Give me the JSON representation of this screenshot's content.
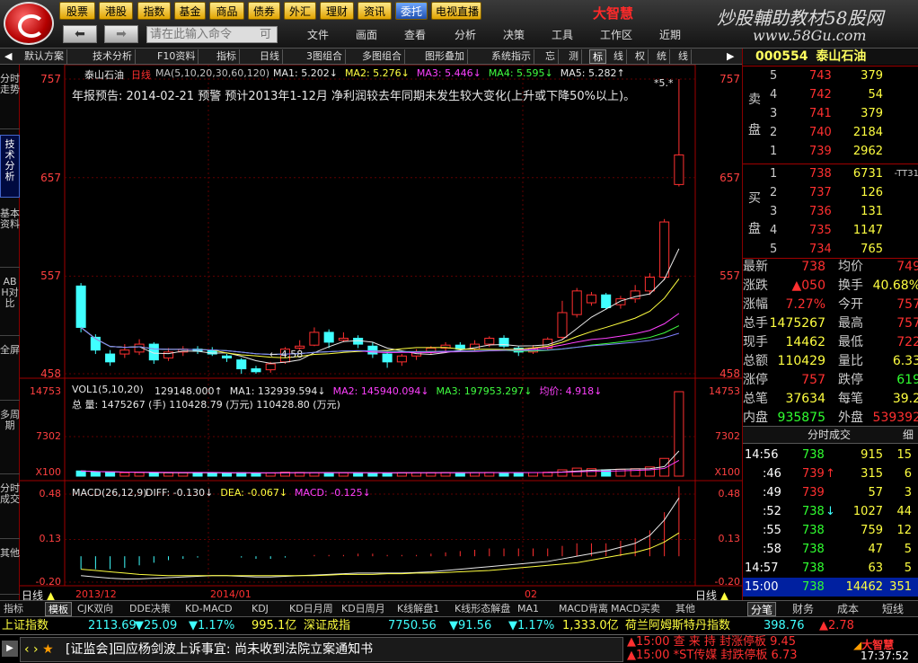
{
  "menu": {
    "top_buttons": [
      "股票",
      "港股",
      "指数",
      "基金",
      "商品",
      "债券",
      "外汇",
      "理财",
      "资讯",
      "委托",
      "电视直播"
    ],
    "active_button": "委托",
    "brand": "大智慧",
    "site_title": "炒股輔助教材58股网",
    "site_url": "www.58Gu.com",
    "cmd_placeholder": "请在此输入命令",
    "cmd_hint": "可",
    "menu_items": [
      "文件",
      "画面",
      "查看",
      "分析",
      "决策",
      "工具",
      "工作区",
      "近期"
    ]
  },
  "toolbar2": [
    "默认方案",
    "技术分析",
    "F10资料",
    "指标",
    "日线",
    "3图组合",
    "多图组合",
    "图形叠加",
    "系统指示",
    "忘",
    "测",
    "标",
    "线",
    "权",
    "统",
    "线"
  ],
  "lefttabs": [
    "分时走势",
    "技术分析",
    "基本资料",
    "ABH对比",
    "全屏",
    "多周期",
    "分时成交",
    "其他"
  ],
  "chart": {
    "stock_name": "泰山石油",
    "period": "日线",
    "ma_params": "MA(5,10,20,30,60,120)",
    "ma_values": [
      {
        "label": "MA1:",
        "value": "5.202",
        "dir": "↓",
        "color": "#e8e8e8"
      },
      {
        "label": "MA2:",
        "value": "5.276",
        "dir": "↓",
        "color": "#ffff40"
      },
      {
        "label": "MA3:",
        "value": "5.446",
        "dir": "↓",
        "color": "#ff40ff"
      },
      {
        "label": "MA4:",
        "value": "5.595",
        "dir": "↓",
        "color": "#40ff40"
      },
      {
        "label": "MA5:",
        "value": "5.282",
        "dir": "↑",
        "color": "#e8e8e8"
      }
    ],
    "announcement": "年报预告: 2014-02-21    预警    预计2013年1-12月   净利润较去年同期未发生较大变化(上升或下降50%以上)。",
    "price_axis": [
      "757",
      "657",
      "557",
      "458"
    ],
    "low_marker": "4.58",
    "high_marker": "*5.*",
    "volume_title": "VOL1(5,10,20)",
    "volume_line": [
      {
        "label": "",
        "value": "129148.000",
        "dir": "↑",
        "color": "#e8e8e8"
      },
      {
        "label": "MA1:",
        "value": "132939.594",
        "dir": "↓",
        "color": "#e8e8e8"
      },
      {
        "label": "MA2:",
        "value": "145940.094",
        "dir": "↓",
        "color": "#ff40ff"
      },
      {
        "label": "MA3:",
        "value": "197953.297",
        "dir": "↓",
        "color": "#40ff40"
      },
      {
        "label": "均价:",
        "value": "4.918",
        "dir": "↓",
        "color": "#ff40ff"
      }
    ],
    "total_line": "总 量: 1475267 (手)  110428.79 (万元)  110428.80 (万元)",
    "vol_axis": [
      "14753",
      "7302",
      "X100"
    ],
    "macd_title": "MACD(26,12,9)",
    "macd_line": [
      {
        "label": "DIFF:",
        "value": "-0.130",
        "dir": "↓",
        "color": "#e8e8e8"
      },
      {
        "label": "DEA:",
        "value": "-0.067",
        "dir": "↓",
        "color": "#ffff40"
      },
      {
        "label": "MACD:",
        "value": "-0.125",
        "dir": "↓",
        "color": "#ff40ff"
      }
    ],
    "macd_axis": [
      "0.48",
      "0.13",
      "-0.20"
    ],
    "date_labels": [
      "2013/12",
      "2014/01",
      "02"
    ],
    "period_label": "日线"
  },
  "chart_data": {
    "type": "candlestick",
    "stock": "泰山石油",
    "ylim": [
      458,
      757
    ],
    "candles": [
      {
        "o": 547,
        "c": 505,
        "h": 550,
        "l": 500
      },
      {
        "o": 495,
        "c": 482,
        "h": 498,
        "l": 478
      },
      {
        "o": 478,
        "c": 470,
        "h": 482,
        "l": 466
      },
      {
        "o": 478,
        "c": 482,
        "h": 488,
        "l": 474
      },
      {
        "o": 480,
        "c": 488,
        "h": 493,
        "l": 477
      },
      {
        "o": 488,
        "c": 472,
        "h": 490,
        "l": 468
      },
      {
        "o": 474,
        "c": 480,
        "h": 484,
        "l": 471
      },
      {
        "o": 480,
        "c": 483,
        "h": 486,
        "l": 476
      },
      {
        "o": 483,
        "c": 481,
        "h": 486,
        "l": 478
      },
      {
        "o": 482,
        "c": 478,
        "h": 485,
        "l": 476
      },
      {
        "o": 476,
        "c": 474,
        "h": 478,
        "l": 470
      },
      {
        "o": 472,
        "c": 463,
        "h": 474,
        "l": 458
      },
      {
        "o": 463,
        "c": 460,
        "h": 466,
        "l": 458
      },
      {
        "o": 462,
        "c": 468,
        "h": 470,
        "l": 459
      },
      {
        "o": 470,
        "c": 483,
        "h": 485,
        "l": 468
      },
      {
        "o": 484,
        "c": 486,
        "h": 492,
        "l": 482
      },
      {
        "o": 487,
        "c": 500,
        "h": 505,
        "l": 486
      },
      {
        "o": 500,
        "c": 490,
        "h": 503,
        "l": 484
      },
      {
        "o": 492,
        "c": 494,
        "h": 500,
        "l": 490
      },
      {
        "o": 494,
        "c": 488,
        "h": 497,
        "l": 484
      },
      {
        "o": 486,
        "c": 478,
        "h": 490,
        "l": 474
      },
      {
        "o": 478,
        "c": 470,
        "h": 480,
        "l": 464
      },
      {
        "o": 470,
        "c": 476,
        "h": 478,
        "l": 466
      },
      {
        "o": 476,
        "c": 480,
        "h": 483,
        "l": 472
      },
      {
        "o": 480,
        "c": 484,
        "h": 486,
        "l": 478
      },
      {
        "o": 484,
        "c": 487,
        "h": 490,
        "l": 480
      },
      {
        "o": 487,
        "c": 483,
        "h": 490,
        "l": 481
      },
      {
        "o": 483,
        "c": 488,
        "h": 492,
        "l": 481
      },
      {
        "o": 488,
        "c": 494,
        "h": 496,
        "l": 485
      },
      {
        "o": 494,
        "c": 486,
        "h": 497,
        "l": 484
      },
      {
        "o": 484,
        "c": 480,
        "h": 486,
        "l": 476
      },
      {
        "o": 480,
        "c": 484,
        "h": 487,
        "l": 478
      },
      {
        "o": 484,
        "c": 493,
        "h": 495,
        "l": 482
      },
      {
        "o": 495,
        "c": 520,
        "h": 532,
        "l": 493
      },
      {
        "o": 518,
        "c": 542,
        "h": 545,
        "l": 515
      },
      {
        "o": 530,
        "c": 538,
        "h": 541,
        "l": 527
      },
      {
        "o": 538,
        "c": 525,
        "h": 540,
        "l": 523
      },
      {
        "o": 528,
        "c": 534,
        "h": 537,
        "l": 524
      },
      {
        "o": 534,
        "c": 542,
        "h": 548,
        "l": 530
      },
      {
        "o": 542,
        "c": 556,
        "h": 560,
        "l": 538
      },
      {
        "o": 556,
        "c": 612,
        "h": 615,
        "l": 553
      },
      {
        "o": 650,
        "c": 680,
        "h": 757,
        "l": 648
      }
    ],
    "volume_ylim": [
      0,
      14753
    ],
    "volume": [
      900,
      700,
      650,
      600,
      620,
      600,
      580,
      590,
      560,
      580,
      560,
      600,
      520,
      560,
      700,
      650,
      620,
      600,
      590,
      580,
      560,
      560,
      600,
      600,
      620,
      640,
      610,
      620,
      650,
      620,
      600,
      620,
      700,
      1100,
      1400,
      1300,
      1100,
      1200,
      1300,
      1600,
      3100,
      14753
    ],
    "macd_ylim": [
      -0.2,
      0.48
    ],
    "diff": [
      -0.15,
      -0.16,
      -0.17,
      -0.175,
      -0.175,
      -0.17,
      -0.165,
      -0.16,
      -0.155,
      -0.15,
      -0.15,
      -0.155,
      -0.16,
      -0.16,
      -0.155,
      -0.15,
      -0.145,
      -0.14,
      -0.135,
      -0.13,
      -0.13,
      -0.13,
      -0.13,
      -0.125,
      -0.12,
      -0.11,
      -0.1,
      -0.09,
      -0.08,
      -0.07,
      -0.06,
      -0.05,
      -0.04,
      -0.02,
      0.0,
      0.02,
      0.04,
      0.07,
      0.1,
      0.16,
      0.28,
      0.45
    ],
    "dea": [
      -0.1,
      -0.11,
      -0.12,
      -0.13,
      -0.14,
      -0.145,
      -0.15,
      -0.15,
      -0.15,
      -0.15,
      -0.15,
      -0.15,
      -0.15,
      -0.15,
      -0.15,
      -0.15,
      -0.15,
      -0.145,
      -0.14,
      -0.14,
      -0.14,
      -0.135,
      -0.135,
      -0.13,
      -0.13,
      -0.125,
      -0.12,
      -0.115,
      -0.11,
      -0.1,
      -0.09,
      -0.08,
      -0.07,
      -0.06,
      -0.05,
      -0.03,
      -0.01,
      0.01,
      0.03,
      0.06,
      0.11,
      0.18
    ]
  },
  "quote": {
    "code": "000554",
    "name": "泰山石油",
    "sell": [
      {
        "lv": "5",
        "price": "743",
        "vol": "379"
      },
      {
        "lv": "4",
        "price": "742",
        "vol": "54"
      },
      {
        "lv": "3",
        "price": "741",
        "vol": "379"
      },
      {
        "lv": "2",
        "price": "740",
        "vol": "2184"
      },
      {
        "lv": "1",
        "price": "739",
        "vol": "2962"
      }
    ],
    "buy": [
      {
        "lv": "1",
        "price": "738",
        "vol": "6731",
        "extra": "-TT31"
      },
      {
        "lv": "2",
        "price": "737",
        "vol": "126",
        "extra": ""
      },
      {
        "lv": "3",
        "price": "736",
        "vol": "131",
        "extra": ""
      },
      {
        "lv": "4",
        "price": "735",
        "vol": "1147",
        "extra": ""
      },
      {
        "lv": "5",
        "price": "734",
        "vol": "765",
        "extra": ""
      }
    ],
    "sell_label": "卖 盘",
    "buy_label": "买 盘",
    "stats": [
      {
        "k1": "最新",
        "v1": "738",
        "c1": "#ff3030",
        "k2": "均价",
        "v2": "749",
        "c2": "#ff3030"
      },
      {
        "k1": "涨跌",
        "v1": "▲050",
        "c1": "#ff3030",
        "k2": "换手",
        "v2": "40.68%",
        "c2": "#ffff40"
      },
      {
        "k1": "涨幅",
        "v1": "7.27%",
        "c1": "#ff3030",
        "k2": "今开",
        "v2": "757",
        "c2": "#ff3030"
      },
      {
        "k1": "总手",
        "v1": "1475267",
        "c1": "#ffff40",
        "k2": "最高",
        "v2": "757",
        "c2": "#ff3030"
      },
      {
        "k1": "现手",
        "v1": "14462",
        "c1": "#ffff40",
        "k2": "最低",
        "v2": "722",
        "c2": "#ff3030"
      },
      {
        "k1": "总额",
        "v1": "110429",
        "c1": "#ffff40",
        "k2": "量比",
        "v2": "6.33",
        "c2": "#ffff40"
      },
      {
        "k1": "涨停",
        "v1": "757",
        "c1": "#ff3030",
        "k2": "跌停",
        "v2": "619",
        "c2": "#30ff30"
      },
      {
        "k1": "总笔",
        "v1": "37634",
        "c1": "#ffff40",
        "k2": "每笔",
        "v2": "39.2",
        "c2": "#ffff40"
      },
      {
        "k1": "内盘",
        "v1": "935875",
        "c1": "#30ff30",
        "k2": "外盘",
        "v2": "539392",
        "c2": "#ff3030"
      }
    ],
    "ticks_title": "分时成交",
    "ticks_tab": "细",
    "ticks": [
      {
        "t": "14:56",
        "p": "738",
        "arrow": "",
        "v": "915",
        "n": "15",
        "pc": "#30ff30"
      },
      {
        "t": ":46",
        "p": "739",
        "arrow": "↑",
        "v": "315",
        "n": "6",
        "pc": "#ff3030"
      },
      {
        "t": ":49",
        "p": "739",
        "arrow": "",
        "v": "57",
        "n": "3",
        "pc": "#ff3030"
      },
      {
        "t": ":52",
        "p": "738",
        "arrow": "↓",
        "v": "1027",
        "n": "44",
        "pc": "#30ff30"
      },
      {
        "t": ":55",
        "p": "738",
        "arrow": "",
        "v": "759",
        "n": "12",
        "pc": "#30ff30"
      },
      {
        "t": ":58",
        "p": "738",
        "arrow": "",
        "v": "47",
        "n": "5",
        "pc": "#30ff30"
      },
      {
        "t": "14:57",
        "p": "738",
        "arrow": "",
        "v": "63",
        "n": "5",
        "pc": "#30ff30"
      },
      {
        "t": "15:00",
        "p": "738",
        "arrow": "",
        "v": "14462",
        "n": "351",
        "pc": "#30ff30"
      }
    ],
    "bottom_tabs": [
      "分笔",
      "财务",
      "成本",
      "短线"
    ]
  },
  "bottom_tabs": [
    "指标",
    "模板",
    "CJK双向",
    "DDE决策",
    "KD-MACD",
    "KDJ",
    "KD日月周",
    "KD日周月",
    "K线解盘1",
    "K线形态解盘",
    "MA1",
    "MACD背离",
    "MACD买卖",
    "其他"
  ],
  "index_bar": [
    {
      "name": "上证指数",
      "val": "2113.69",
      "chg": "▼25.09",
      "pct": "▼1.17%",
      "amt": "995.1亿"
    },
    {
      "name": "深证成指",
      "val": "7750.56",
      "chg": "▼91.56",
      "pct": "▼1.17%",
      "amt": "1,333.0亿"
    },
    {
      "name": "荷兰阿姆斯特丹指数",
      "val": "398.76",
      "chg": "▲2.78",
      "pct": "",
      "amt": ""
    }
  ],
  "news": {
    "text": "[证监会]回应杨剑波上诉事宜: 尚未收到法院立案通知书",
    "alert1": "▲15:00 查 来 持 封涨停板 9.45",
    "alert2": "▲15:00 *ST传媒 封跌停板 6.73",
    "brand": "大智慧",
    "time": "17:37:52"
  }
}
